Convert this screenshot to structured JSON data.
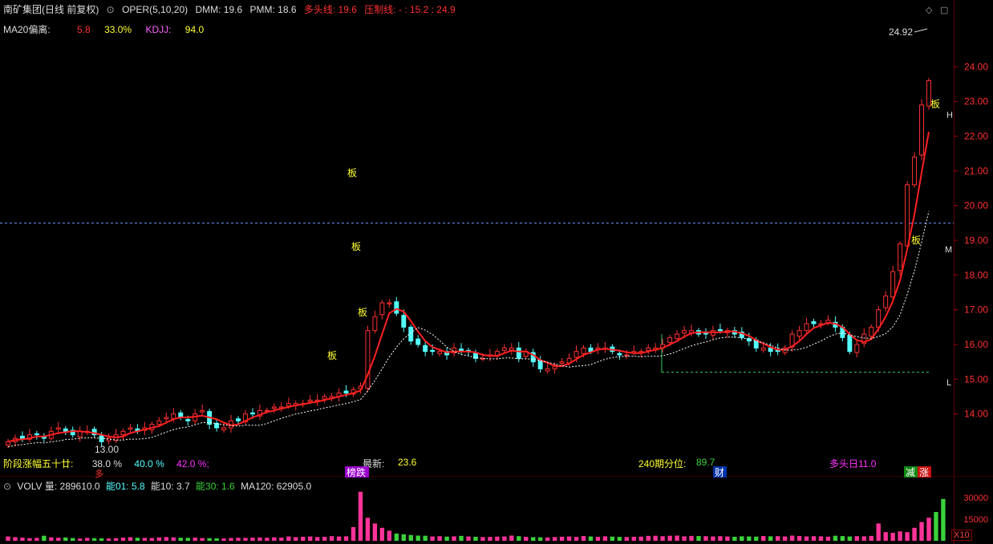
{
  "header": {
    "title": "南矿集团(日线 前复权)",
    "indicator": "OPER(5,10,20)",
    "dmm": "DMM: 19.6",
    "pmm": "PMM: 18.6",
    "bull_label": "多头线: 19.6",
    "press_label": "压制线: - : 15.2 : 24.9"
  },
  "row2": {
    "ma20_label": "MA20偏离:",
    "ma20_value": "5.8",
    "pct": "33.0%",
    "kdjj_label": "KDJJ:",
    "kdjj_value": "94.0"
  },
  "stage": {
    "label": "阶段涨幅五十廿:",
    "v1": "38.0 %",
    "v2": "40.0 %",
    "v3": "42.0 %;",
    "latest_label": "最新:",
    "latest_value": "23.6",
    "pct240_label": "240期分位:",
    "pct240_value": "89.7",
    "bull_days": "多头日11.0"
  },
  "tags": {
    "bang": "榜跌",
    "cai": "财",
    "jian": "减",
    "zhang": "涨"
  },
  "volume": {
    "title": "VOLV 量: 289610.0",
    "n01": "能01: 5.8",
    "n10": "能10: 3.7",
    "n30": "能30: 1.6",
    "ma120": "MA120: 62905.0",
    "x10": "X10",
    "yticks": [
      "30000",
      "15000"
    ]
  },
  "annotations": {
    "max_label": "24.92",
    "min_label": "13.00",
    "board": "板",
    "h_label": "H",
    "m_label": "M",
    "l_label": "L",
    "bull_tag": "多"
  },
  "colors": {
    "up": "#ff3030",
    "down": "#54ffff",
    "ma": "#ff2020",
    "yellow": "#ffff33",
    "green": "#3bd13b",
    "magenta": "#ff3399",
    "dashed": "#6699ff"
  },
  "chart_data": {
    "type": "candlestick",
    "y_axis": {
      "min": 13.0,
      "max": 25.0,
      "ticks": [
        14.0,
        15.0,
        16.0,
        17.0,
        18.0,
        19.0,
        20.0,
        21.0,
        22.0,
        23.0,
        24.0
      ]
    },
    "reference_line": 19.5,
    "support_line": 15.2,
    "close": [
      13.2,
      13.3,
      13.3,
      13.4,
      13.4,
      13.3,
      13.5,
      13.6,
      13.5,
      13.4,
      13.5,
      13.5,
      13.4,
      13.2,
      13.3,
      13.4,
      13.5,
      13.6,
      13.5,
      13.6,
      13.7,
      13.8,
      13.9,
      14.0,
      13.9,
      13.8,
      14.0,
      14.1,
      13.7,
      13.6,
      13.6,
      13.8,
      13.8,
      14.0,
      14.0,
      14.1,
      14.1,
      14.2,
      14.2,
      14.3,
      14.3,
      14.3,
      14.4,
      14.4,
      14.5,
      14.5,
      14.6,
      14.6,
      14.7,
      14.8,
      16.4,
      16.8,
      17.2,
      17.2,
      16.9,
      16.5,
      16.1,
      16.0,
      15.8,
      15.8,
      15.8,
      15.7,
      15.9,
      15.8,
      15.8,
      15.6,
      15.6,
      15.7,
      15.8,
      15.9,
      15.9,
      15.6,
      15.8,
      15.5,
      15.3,
      15.3,
      15.4,
      15.5,
      15.6,
      15.8,
      15.9,
      15.8,
      15.9,
      15.9,
      15.8,
      15.7,
      15.7,
      15.8,
      15.8,
      15.9,
      15.9,
      16.0,
      16.2,
      16.3,
      16.4,
      16.4,
      16.3,
      16.3,
      16.4,
      16.4,
      16.4,
      16.3,
      16.2,
      16.1,
      15.9,
      15.9,
      15.8,
      15.8,
      15.9,
      16.3,
      16.4,
      16.6,
      16.6,
      16.6,
      16.7,
      16.5,
      16.2,
      15.8,
      16.0,
      16.3,
      16.5,
      17.0,
      17.4,
      18.1,
      18.9,
      20.6,
      21.4,
      22.9,
      23.6
    ],
    "volume": [
      3000,
      2500,
      2200,
      1800,
      2000,
      3500,
      2400,
      2100,
      2300,
      1900,
      1500,
      2000,
      1800,
      1700,
      1600,
      1800,
      2200,
      2500,
      2100,
      2000,
      1900,
      2300,
      2600,
      2400,
      2100,
      2000,
      2200,
      1900,
      1800,
      1700,
      1600,
      1900,
      2100,
      2000,
      2200,
      2300,
      2100,
      2400,
      2200,
      3000,
      2500,
      2800,
      3000,
      2600,
      2800,
      3200,
      3000,
      3100,
      9500,
      34000,
      16000,
      12000,
      9000,
      7000,
      5000,
      4500,
      4000,
      3600,
      3500,
      3000,
      3200,
      2900,
      3100,
      3400,
      3000,
      2800,
      2600,
      2700,
      2900,
      3000,
      3600,
      3200,
      2800,
      2500,
      2400,
      2300,
      2600,
      2800,
      3000,
      2700,
      3300,
      3000,
      2800,
      3100,
      2900,
      2700,
      2600,
      2800,
      2900,
      3400,
      3500,
      3200,
      3500,
      3600,
      3100,
      3400,
      3300,
      3200,
      3000,
      3200,
      3000,
      2800,
      3100,
      3000,
      2900,
      3300,
      3100,
      3200,
      3000,
      3600,
      3300,
      3000,
      3200,
      3100,
      2900,
      3500,
      3300,
      3000,
      3200,
      3100,
      3400,
      12000,
      6000,
      5500,
      6500,
      6000,
      9000,
      13000,
      16000,
      20000,
      29000
    ],
    "series": [
      {
        "name": "多头线",
        "type": "line"
      },
      {
        "name": "压制线",
        "type": "line"
      }
    ]
  }
}
